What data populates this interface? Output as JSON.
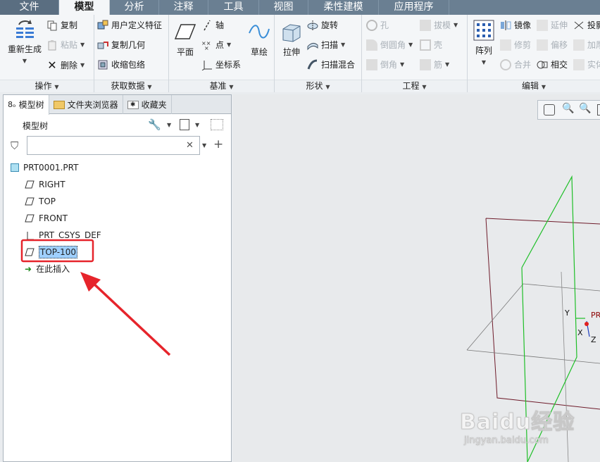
{
  "tabs": [
    "文件",
    "模型",
    "分析",
    "注释",
    "工具",
    "视图",
    "柔性建模",
    "应用程序"
  ],
  "active_tab": "模型",
  "ribbon": {
    "groups": {
      "ops": "操作",
      "getdata": "获取数据",
      "datum": "基准",
      "shape": "形状",
      "eng": "工程",
      "edit": "编辑"
    },
    "regen": "重新生成",
    "copy": "复制",
    "paste": "粘贴",
    "delete": "删除",
    "udf": "用户定义特征",
    "copygeom": "复制几何",
    "shrinkwrap": "收缩包络",
    "plane": "平面",
    "axis": "轴",
    "point": "点",
    "csys": "坐标系",
    "sketch": "草绘",
    "extrude": "拉伸",
    "revolve": "旋转",
    "sweep": "扫描",
    "sweepblend": "扫描混合",
    "hole": "孔",
    "round": "倒圆角",
    "chamfer": "倒角",
    "draft": "拔模",
    "shell": "壳",
    "rib": "筋",
    "pattern": "阵列",
    "mirror": "镜像",
    "trim": "修剪",
    "merge": "合并",
    "extend": "延伸",
    "offset": "偏移",
    "intersect": "相交",
    "project": "投影",
    "thicken": "加厚",
    "solidify": "实体化"
  },
  "panel": {
    "tabs": [
      "模型树",
      "文件夹浏览器",
      "收藏夹"
    ],
    "tree_title": "模型树",
    "filter_value": "",
    "items": [
      {
        "label": "PRT0001.PRT",
        "type": "part"
      },
      {
        "label": "RIGHT",
        "type": "plane"
      },
      {
        "label": "TOP",
        "type": "plane"
      },
      {
        "label": "FRONT",
        "type": "plane"
      },
      {
        "label": "PRT_CSYS_DEF",
        "type": "csys"
      },
      {
        "label": "TOP-100",
        "type": "plane",
        "selected": true
      },
      {
        "label": "在此插入",
        "type": "insert"
      }
    ]
  },
  "viewport": {
    "axis_labels": [
      "Y",
      "X",
      "Z"
    ],
    "csys_label": "PR"
  },
  "watermark": {
    "text": "Baidu经验",
    "sub": "jingyan.baidu.com"
  },
  "colors": {
    "tab_bg": "#6a7f92",
    "highlight_red": "#e6242b",
    "datum_green": "#1fbf28",
    "datum_maroon": "#6e1b2a",
    "selection_blue": "#9fd0ff"
  }
}
